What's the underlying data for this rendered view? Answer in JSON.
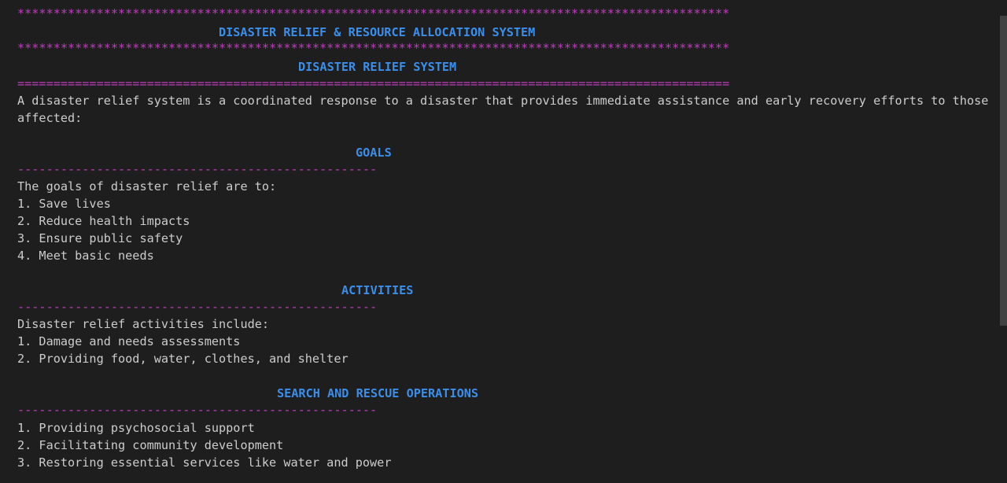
{
  "terminal": {
    "stars_top": "***************************************************************************************************",
    "title": "DISASTER RELIEF & RESOURCE ALLOCATION SYSTEM",
    "stars_bottom": "***************************************************************************************************",
    "heading": "DISASTER RELIEF SYSTEM",
    "equals_rule": "===================================================================================================",
    "intro_line1": "A disaster relief system is a coordinated response to a disaster that provides immediate assistance and early recovery efforts to those",
    "intro_line2": "affected:",
    "dash_rule": "--------------------------------------------------",
    "goals": {
      "heading": "GOALS",
      "intro": "The goals of disaster relief are to:",
      "items": [
        "1. Save lives",
        "2. Reduce health impacts",
        "3. Ensure public safety",
        "4. Meet basic needs"
      ]
    },
    "activities": {
      "heading": "ACTIVITIES",
      "intro": "Disaster relief activities include:",
      "items": [
        "1. Damage and needs assessments",
        "2. Providing food, water, clothes, and shelter"
      ]
    },
    "search": {
      "heading": "SEARCH AND RESCUE OPERATIONS",
      "items": [
        "1. Providing psychosocial support",
        "2. Facilitating community development",
        "3. Restoring essential services like water and power"
      ]
    }
  }
}
